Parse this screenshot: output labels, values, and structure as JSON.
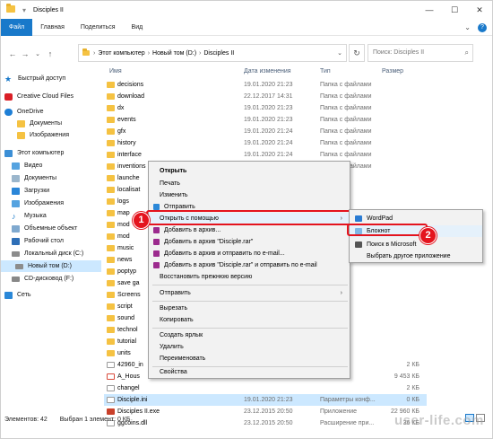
{
  "window": {
    "title": "Disciples II"
  },
  "ribbon": {
    "tabs": [
      "Файл",
      "Главная",
      "Поделиться",
      "Вид"
    ]
  },
  "address": {
    "crumbs": [
      "Этот компьютер",
      "Новый том (D:)",
      "Disciples II"
    ],
    "search_placeholder": "Поиск: Disciples II"
  },
  "nav": {
    "items": [
      "Быстрый доступ",
      "Creative Cloud Files",
      "OneDrive",
      "Документы",
      "Изображения",
      "Этот компьютер",
      "Видео",
      "Документы",
      "Загрузки",
      "Изображения",
      "Музыка",
      "Объемные объект",
      "Рабочий стол",
      "Локальный диск (C:)",
      "Новый том (D:)",
      "CD-дисковод (F:)",
      "Сеть"
    ]
  },
  "columns": {
    "name": "Имя",
    "date": "Дата изменения",
    "type": "Тип",
    "size": "Размер"
  },
  "files": [
    {
      "name": "decisions",
      "date": "19.01.2020 21:23",
      "type": "Папка с файлами",
      "size": ""
    },
    {
      "name": "download",
      "date": "22.12.2017 14:31",
      "type": "Папка с файлами",
      "size": ""
    },
    {
      "name": "dx",
      "date": "19.01.2020 21:23",
      "type": "Папка с файлами",
      "size": ""
    },
    {
      "name": "events",
      "date": "19.01.2020 21:23",
      "type": "Папка с файлами",
      "size": ""
    },
    {
      "name": "gfx",
      "date": "19.01.2020 21:24",
      "type": "Папка с файлами",
      "size": ""
    },
    {
      "name": "history",
      "date": "19.01.2020 21:24",
      "type": "Папка с файлами",
      "size": ""
    },
    {
      "name": "interface",
      "date": "19.01.2020 21:24",
      "type": "Папка с файлами",
      "size": ""
    },
    {
      "name": "inventions",
      "date": "19.01.2020 21:24",
      "type": "Папка с файлами",
      "size": ""
    },
    {
      "name": "launche",
      "date": "",
      "type": "",
      "size": ""
    },
    {
      "name": "localisat",
      "date": "",
      "type": "",
      "size": ""
    },
    {
      "name": "logs",
      "date": "",
      "type": "",
      "size": ""
    },
    {
      "name": "map",
      "date": "",
      "type": "",
      "size": ""
    },
    {
      "name": "mod",
      "date": "",
      "type": "",
      "size": ""
    },
    {
      "name": "mod",
      "date": "",
      "type": "",
      "size": ""
    },
    {
      "name": "music",
      "date": "",
      "type": "",
      "size": ""
    },
    {
      "name": "news",
      "date": "",
      "type": "",
      "size": ""
    },
    {
      "name": "poptyp",
      "date": "",
      "type": "",
      "size": ""
    },
    {
      "name": "save ga",
      "date": "",
      "type": "",
      "size": ""
    },
    {
      "name": "Screens",
      "date": "",
      "type": "",
      "size": ""
    },
    {
      "name": "script",
      "date": "",
      "type": "",
      "size": ""
    },
    {
      "name": "sound",
      "date": "",
      "type": "",
      "size": ""
    },
    {
      "name": "technol",
      "date": "",
      "type": "",
      "size": ""
    },
    {
      "name": "tutorial",
      "date": "",
      "type": "",
      "size": ""
    },
    {
      "name": "units",
      "date": "",
      "type": "",
      "size": ""
    },
    {
      "name": "42960_in",
      "date": "",
      "type": "",
      "size": "2 КБ"
    },
    {
      "name": "A_Hous",
      "date": "",
      "type": "obat D...",
      "size": "9 453 КБ"
    },
    {
      "name": "changel",
      "date": "",
      "type": "",
      "size": "2 КБ"
    },
    {
      "name": "Disciple.ini",
      "date": "19.01.2020 21:23",
      "type": "Параметры конф...",
      "size": "0 КБ"
    },
    {
      "name": "Disciples II.exe",
      "date": "23.12.2015 20:50",
      "type": "Приложение",
      "size": "22 960 КБ"
    },
    {
      "name": "ggcoins.dll",
      "date": "23.12.2015 20:50",
      "type": "Расширение при...",
      "size": "36 КБ"
    }
  ],
  "status": {
    "count": "Элементов: 42",
    "selection": "Выбран 1 элемент: 0 КБ"
  },
  "context_menu": {
    "open": "Открыть",
    "print": "Печать",
    "edit": "Изменить",
    "send": "Отправить",
    "open_with": "Открыть с помощью",
    "add_archive": "Добавить в архив...",
    "add_rar": "Добавить в архив \"Disciple.rar\"",
    "add_email": "Добавить в архив и отправить по e-mail...",
    "add_rar_email": "Добавить в архив \"Disciple.rar\" и отправить по e-mail",
    "restore": "Восстановить прежнюю версию",
    "send_to": "Отправить",
    "cut": "Вырезать",
    "copy": "Копировать",
    "shortcut": "Создать ярлык",
    "delete": "Удалить",
    "rename": "Переименовать",
    "properties": "Свойства"
  },
  "submenu": {
    "wordpad": "WordPad",
    "notepad": "Блокнот",
    "store": "Поиск в Microsoft",
    "other": "Выбрать другое приложение"
  },
  "badges": [
    "1",
    "2"
  ],
  "watermark": "user-life.com"
}
